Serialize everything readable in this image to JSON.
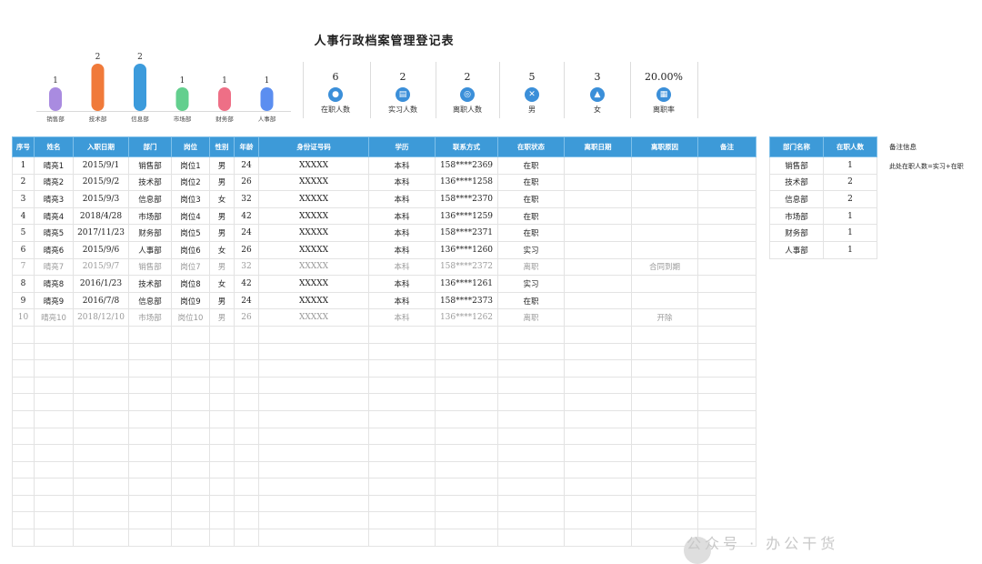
{
  "title": "人事行政档案管理登记表",
  "chart_data": {
    "type": "bar",
    "categories": [
      "销售部",
      "技术部",
      "信息部",
      "市场部",
      "财务部",
      "人事部"
    ],
    "values": [
      1,
      2,
      2,
      1,
      1,
      1
    ],
    "colors": [
      "#a98be0",
      "#f07a3a",
      "#3c9bdc",
      "#63cf8e",
      "#ee6f86",
      "#5b8ef0"
    ],
    "ylim": [
      0,
      2
    ]
  },
  "stats": [
    {
      "value": "6",
      "label": "在职人数",
      "icon": "person-icon"
    },
    {
      "value": "2",
      "label": "实习人数",
      "icon": "document-icon"
    },
    {
      "value": "2",
      "label": "离职人数",
      "icon": "exit-icon"
    },
    {
      "value": "5",
      "label": "男",
      "icon": "male-icon"
    },
    {
      "value": "3",
      "label": "女",
      "icon": "female-icon"
    },
    {
      "value": "20.00%",
      "label": "离职率",
      "icon": "chart-icon"
    }
  ],
  "table": {
    "headers": [
      "序号",
      "姓名",
      "入职日期",
      "部门",
      "岗位",
      "性别",
      "年龄",
      "身份证号码",
      "学历",
      "联系方式",
      "在职状态",
      "离职日期",
      "离职原因",
      "备注"
    ],
    "rows": [
      [
        "1",
        "晴亮1",
        "2015/9/1",
        "销售部",
        "岗位1",
        "男",
        "24",
        "XXXXX",
        "本科",
        "158****2369",
        "在职",
        "",
        "",
        ""
      ],
      [
        "2",
        "晴亮2",
        "2015/9/2",
        "技术部",
        "岗位2",
        "男",
        "26",
        "XXXXX",
        "本科",
        "136****1258",
        "在职",
        "",
        "",
        ""
      ],
      [
        "3",
        "晴亮3",
        "2015/9/3",
        "信息部",
        "岗位3",
        "女",
        "32",
        "XXXXX",
        "本科",
        "158****2370",
        "在职",
        "",
        "",
        ""
      ],
      [
        "4",
        "晴亮4",
        "2018/4/28",
        "市场部",
        "岗位4",
        "男",
        "42",
        "XXXXX",
        "本科",
        "136****1259",
        "在职",
        "",
        "",
        ""
      ],
      [
        "5",
        "晴亮5",
        "2017/11/23",
        "财务部",
        "岗位5",
        "男",
        "24",
        "XXXXX",
        "本科",
        "158****2371",
        "在职",
        "",
        "",
        ""
      ],
      [
        "6",
        "晴亮6",
        "2015/9/6",
        "人事部",
        "岗位6",
        "女",
        "26",
        "XXXXX",
        "本科",
        "136****1260",
        "实习",
        "",
        "",
        ""
      ],
      [
        "7",
        "晴亮7",
        "2015/9/7",
        "销售部",
        "岗位7",
        "男",
        "32",
        "XXXXX",
        "本科",
        "158****2372",
        "离职",
        "",
        "合同到期",
        ""
      ],
      [
        "8",
        "晴亮8",
        "2016/1/23",
        "技术部",
        "岗位8",
        "女",
        "42",
        "XXXXX",
        "本科",
        "136****1261",
        "实习",
        "",
        "",
        ""
      ],
      [
        "9",
        "晴亮9",
        "2016/7/8",
        "信息部",
        "岗位9",
        "男",
        "24",
        "XXXXX",
        "本科",
        "158****2373",
        "在职",
        "",
        "",
        ""
      ],
      [
        "10",
        "晴亮10",
        "2018/12/10",
        "市场部",
        "岗位10",
        "男",
        "26",
        "XXXXX",
        "本科",
        "136****1262",
        "离职",
        "",
        "开除",
        ""
      ]
    ]
  },
  "dept_table": {
    "headers": [
      "部门名称",
      "在职人数"
    ],
    "rows": [
      [
        "销售部",
        "1"
      ],
      [
        "技术部",
        "2"
      ],
      [
        "信息部",
        "2"
      ],
      [
        "市场部",
        "1"
      ],
      [
        "财务部",
        "1"
      ],
      [
        "人事部",
        "1"
      ]
    ]
  },
  "notes": {
    "title": "备注信息",
    "text": "此处在职人数=实习+在职"
  },
  "watermark": "公众号 · 办公干货"
}
